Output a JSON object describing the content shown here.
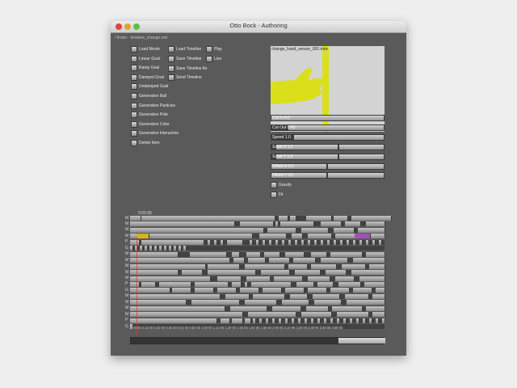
{
  "window": {
    "title": "Otto Bock - Authoring",
    "path": "/ finder · timeline_change.xml"
  },
  "left_checkboxes": [
    {
      "label": "Load Movie"
    },
    {
      "label": "Linear Goal"
    },
    {
      "label": "Ramp Goal"
    },
    {
      "label": "Damped Goal"
    },
    {
      "label": "Undamped Goal"
    },
    {
      "label": "Generative Ball"
    },
    {
      "label": "Generative Particles"
    },
    {
      "label": "Generative Pole"
    },
    {
      "label": "Generative Color"
    },
    {
      "label": "Generative Interaction"
    },
    {
      "label": "Delete Item"
    }
  ],
  "mid_checkboxes": [
    {
      "label": "Load Timeline"
    },
    {
      "label": "Save Timeline"
    },
    {
      "label": "Save Timeline As"
    },
    {
      "label": "Send Timeline"
    }
  ],
  "right_checkboxes": [
    {
      "label": "Play"
    },
    {
      "label": "Live"
    }
  ],
  "preview": {
    "caption": "change_hand_sensor_001.mov",
    "bg_color": "#d3d3d3",
    "accent_color": "#d9e01a"
  },
  "sliders": [
    {
      "label": "Cut In 0.0",
      "value": 0.0
    },
    {
      "label": "Cut Out 0.43",
      "value": 0.43
    },
    {
      "label": "Speed 1.0",
      "value": 1.0
    }
  ],
  "pair_sliders": [
    {
      "label": "Scale X 1.0",
      "value": 1.0
    },
    {
      "label": "Scale Y 1.0",
      "value": 1.0
    },
    {
      "label": "Offset X 0.0",
      "value": 0.0
    },
    {
      "label": "Offset Y 0.0",
      "value": 0.0
    }
  ],
  "toggles": [
    {
      "label": "Gravity"
    },
    {
      "label": "Fit"
    }
  ],
  "timeline": {
    "current_time": "0:05:58",
    "ruler_text": "0 00:00 0:10 00 0:20 00 0:30 00 0:40 00 0:50 00 1:00 00 1:10 00 1:20 00 1:30 00 1:40 00 1:50 00 2:00 00 2:10 00 2:20 00 2:30 00 2:40 00 2:50 00",
    "playhead_color": "#d8322e",
    "track_labels": [
      "M",
      "M",
      "M",
      "M",
      "P",
      "G",
      "M",
      "M",
      "M",
      "M",
      "M",
      "P",
      "G",
      "M",
      "M",
      "M",
      "M",
      "P",
      "G"
    ]
  }
}
